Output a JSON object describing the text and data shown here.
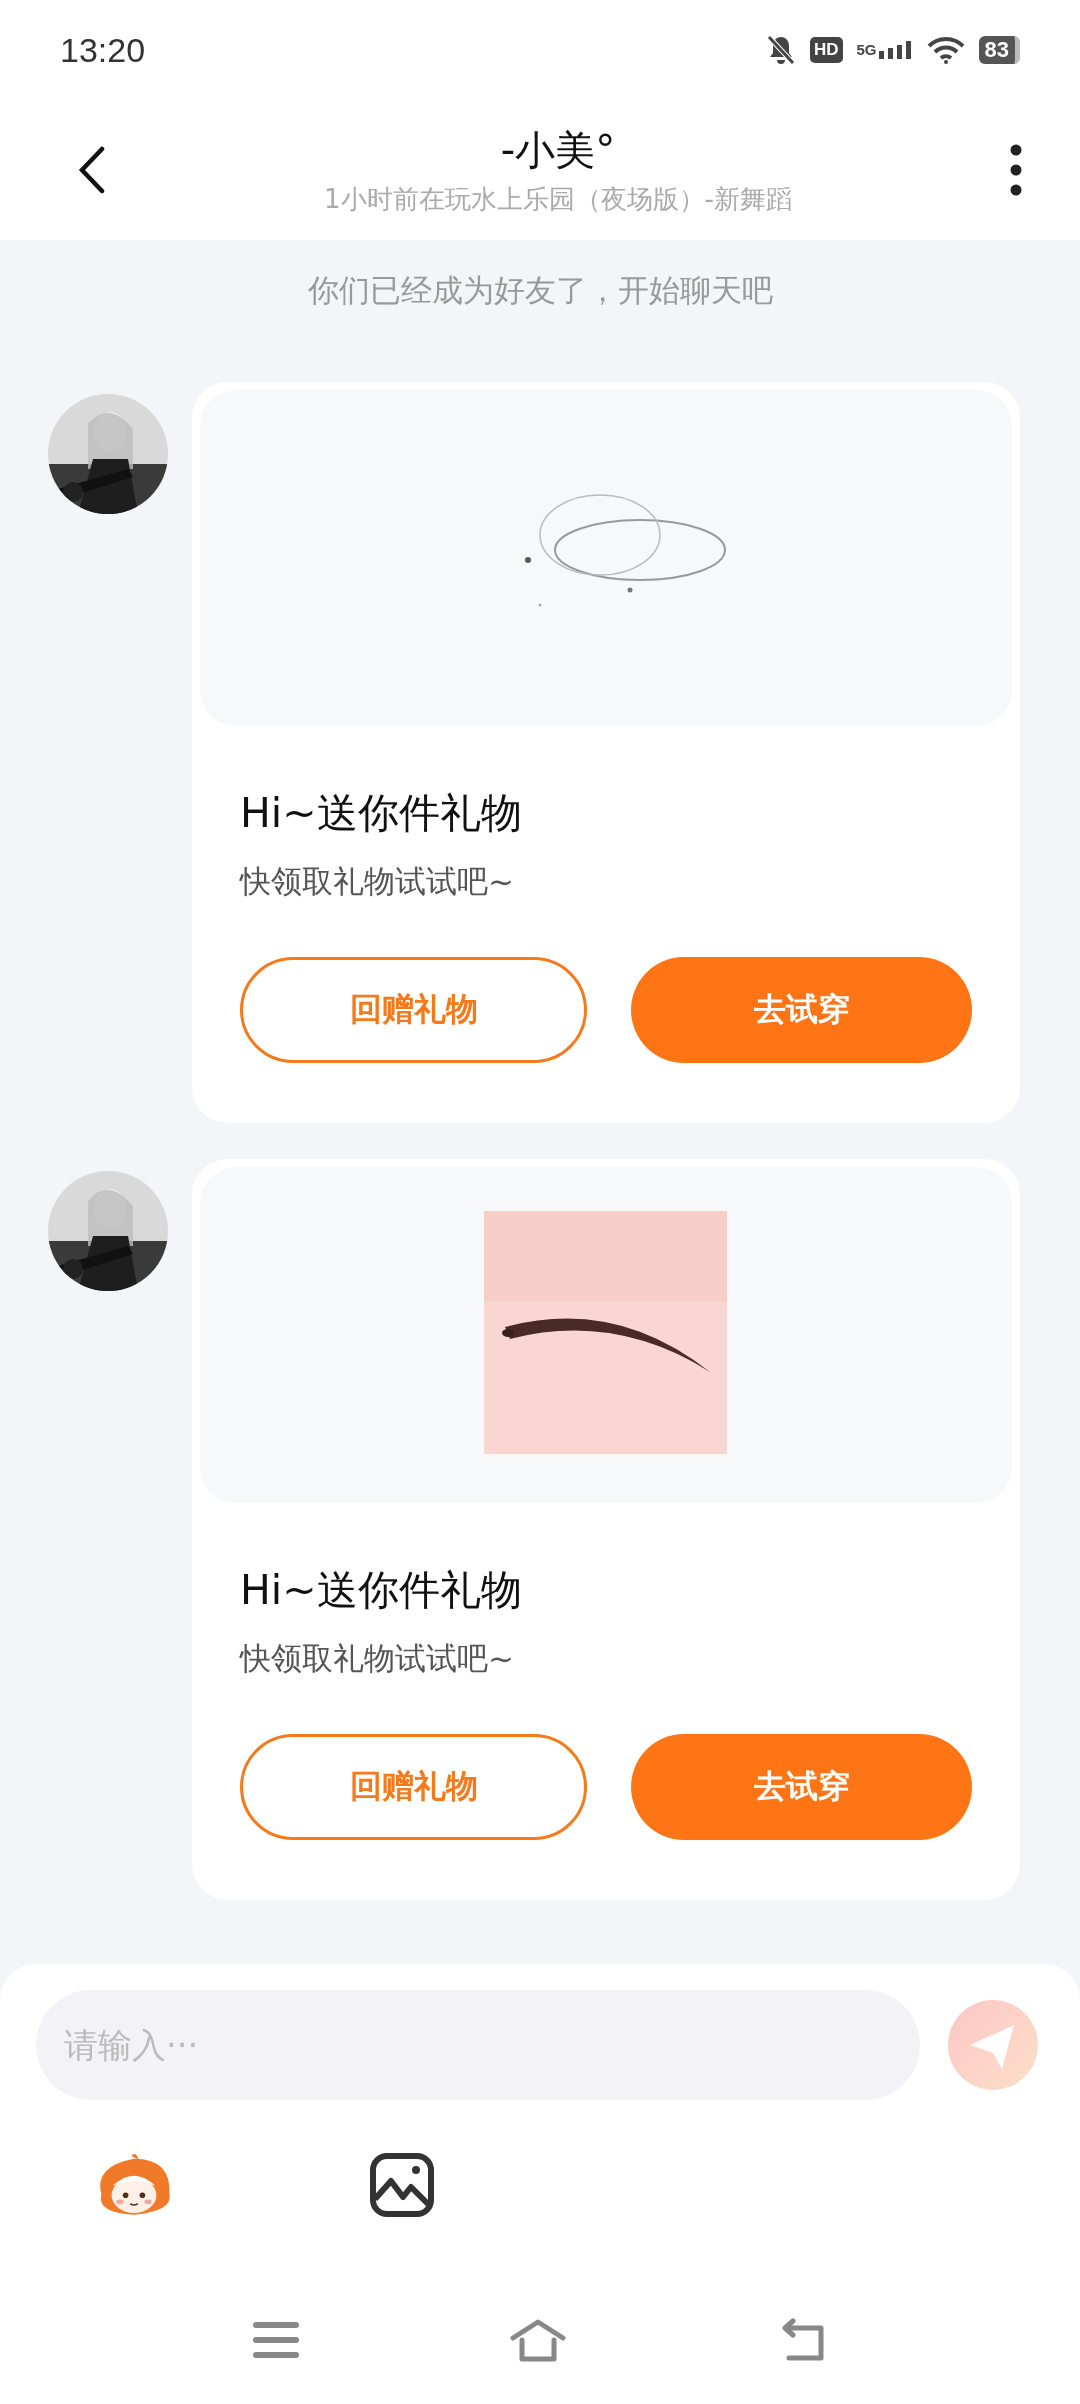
{
  "status_bar": {
    "time": "13:20",
    "hd": "HD",
    "network": "5G",
    "battery": "83"
  },
  "header": {
    "title": "-小美°",
    "subtitle": "1小时前在玩水上乐园（夜场版）-新舞蹈"
  },
  "notice": "你们已经成为好友了，开始聊天吧",
  "messages": [
    {
      "title": "Hi~送你件礼物",
      "text": "快领取礼物试试吧~",
      "buttons": [
        {
          "label": "回赠礼物",
          "kind": "outline"
        },
        {
          "label": "去试穿",
          "kind": "filled"
        }
      ]
    },
    {
      "title": "Hi~送你件礼物",
      "text": "快领取礼物试试吧~",
      "buttons": [
        {
          "label": "回赠礼物",
          "kind": "outline"
        },
        {
          "label": "去试穿",
          "kind": "filled"
        }
      ]
    }
  ],
  "composer": {
    "placeholder": "请输入···"
  }
}
